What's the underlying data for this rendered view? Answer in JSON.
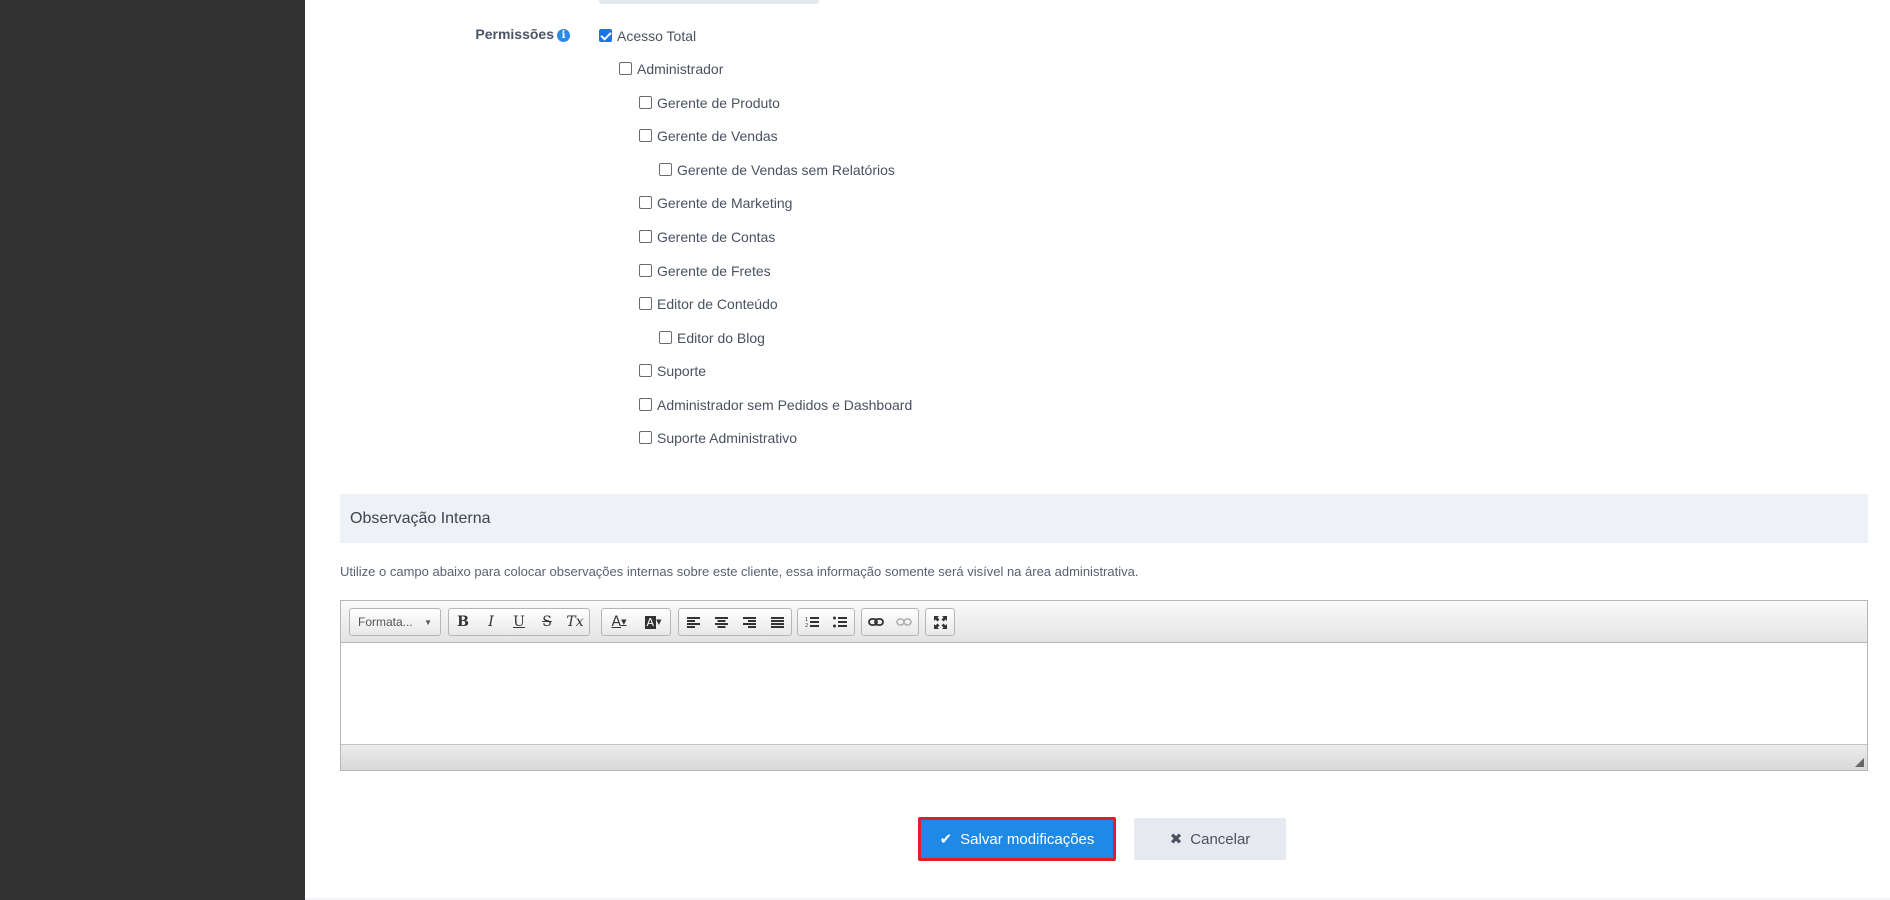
{
  "permissions": {
    "label": "Permissões",
    "info_icon": "info-icon",
    "items": [
      {
        "label": "Acesso Total",
        "checked": true
      },
      {
        "label": "Administrador",
        "checked": false
      },
      {
        "label": "Gerente de Produto",
        "checked": false
      },
      {
        "label": "Gerente de Vendas",
        "checked": false
      },
      {
        "label": "Gerente de Vendas sem Relatórios",
        "checked": false
      },
      {
        "label": "Gerente de Marketing",
        "checked": false
      },
      {
        "label": "Gerente de Contas",
        "checked": false
      },
      {
        "label": "Gerente de Fretes",
        "checked": false
      },
      {
        "label": "Editor de Conteúdo",
        "checked": false
      },
      {
        "label": "Editor do Blog",
        "checked": false
      },
      {
        "label": "Suporte",
        "checked": false
      },
      {
        "label": "Administrador sem Pedidos e Dashboard",
        "checked": false
      },
      {
        "label": "Suporte Administrativo",
        "checked": false
      }
    ]
  },
  "internal_note": {
    "title": "Observação Interna",
    "hint": "Utilize o campo abaixo para colocar observações internas sobre este cliente, essa informação somente será visível na área administrativa."
  },
  "editor": {
    "format_label": "Formata...",
    "buttons": {
      "bold": "B",
      "italic": "I",
      "underline": "U",
      "strike": "S",
      "clear": "Tx",
      "text_color": "A",
      "bg_color": "A"
    }
  },
  "actions": {
    "save_label": "Salvar modificações",
    "cancel_label": "Cancelar"
  },
  "colors": {
    "primary": "#1f8ae6",
    "highlight_border": "#e01d2a",
    "sidebar": "#323232"
  }
}
